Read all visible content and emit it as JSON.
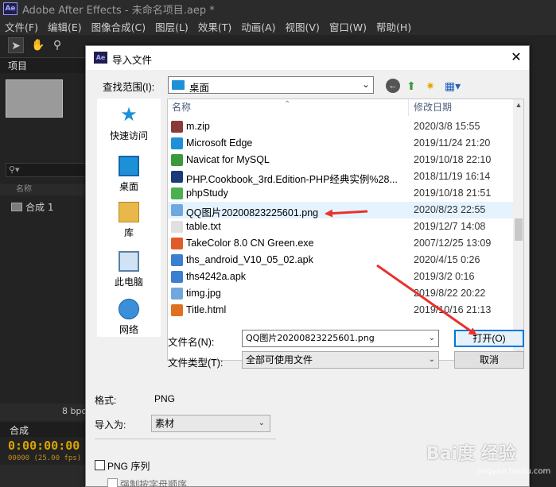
{
  "app": {
    "title": "Adobe After Effects - 未命名项目.aep *",
    "logo_text": "Ae",
    "menu": [
      "文件(F)",
      "编辑(E)",
      "图像合成(C)",
      "图层(L)",
      "效果(T)",
      "动画(A)",
      "视图(V)",
      "窗口(W)",
      "帮助(H)"
    ],
    "project_tab": "项目",
    "search_placeholder": "⚲▾",
    "column_name": "名称",
    "comp_item": "合成 1",
    "bpc": "8 bpc",
    "timeline_tab": "合成",
    "timecode": "0:00:00:00",
    "fps": "00000 (25.00 fps)"
  },
  "dialog": {
    "title": "导入文件",
    "close_glyph": "✕",
    "lookin_label": "查找范围(I):",
    "lookin_value": "桌面",
    "places": [
      {
        "label": "快速访问",
        "icon": "star-icon"
      },
      {
        "label": "桌面",
        "icon": "desktop-icon"
      },
      {
        "label": "库",
        "icon": "library-icon"
      },
      {
        "label": "此电脑",
        "icon": "computer-icon"
      },
      {
        "label": "网络",
        "icon": "network-icon"
      }
    ],
    "columns": {
      "name": "名称",
      "date": "修改日期"
    },
    "files": [
      {
        "name": "m.zip",
        "date": "2020/3/8 15:55",
        "icon_color": "#8b3a3a"
      },
      {
        "name": "Microsoft Edge",
        "date": "2019/11/24 21:20",
        "icon_color": "#1e90d8"
      },
      {
        "name": "Navicat for MySQL",
        "date": "2019/10/18 22:10",
        "icon_color": "#3c9a3c"
      },
      {
        "name": "PHP.Cookbook_3rd.Edition-PHP经典实例%28...",
        "date": "2018/11/19 16:14",
        "icon_color": "#1a3a7a"
      },
      {
        "name": "phpStudy",
        "date": "2019/10/18 21:51",
        "icon_color": "#4caf50"
      },
      {
        "name": "QQ图片20200823225601.png",
        "date": "2020/8/23 22:55",
        "icon_color": "#6fa8dc",
        "selected": true
      },
      {
        "name": "table.txt",
        "date": "2019/12/7 14:08",
        "icon_color": "#e0e0e0"
      },
      {
        "name": "TakeColor 8.0 CN Green.exe",
        "date": "2007/12/25 13:09",
        "icon_color": "#e05a2a"
      },
      {
        "name": "ths_android_V10_05_02.apk",
        "date": "2020/4/15 0:26",
        "icon_color": "#3a7fd0"
      },
      {
        "name": "ths4242a.apk",
        "date": "2019/3/2 0:16",
        "icon_color": "#3a7fd0"
      },
      {
        "name": "timg.jpg",
        "date": "2019/8/22 20:22",
        "icon_color": "#6fa8dc"
      },
      {
        "name": "Title.html",
        "date": "2019/10/16 21:13",
        "icon_color": "#e07020"
      }
    ],
    "filename_label": "文件名(N):",
    "filename_value": "QQ图片20200823225601.png",
    "filetype_label": "文件类型(T):",
    "filetype_value": "全部可使用文件",
    "open_label": "打开(O)",
    "cancel_label": "取消",
    "format_label": "格式:",
    "format_value": "PNG",
    "importas_label": "导入为:",
    "importas_value": "素材",
    "png_sequence_label": "PNG 序列",
    "alpha_order_label": "强制按字母顺序"
  },
  "watermark": {
    "text": "Bai度 经验",
    "sub": "jingyan.baidu.com"
  },
  "colors": {
    "annotation_arrow": "#e8322a",
    "selection": "#e5f3ff",
    "primary_button_border": "#0078d7"
  }
}
